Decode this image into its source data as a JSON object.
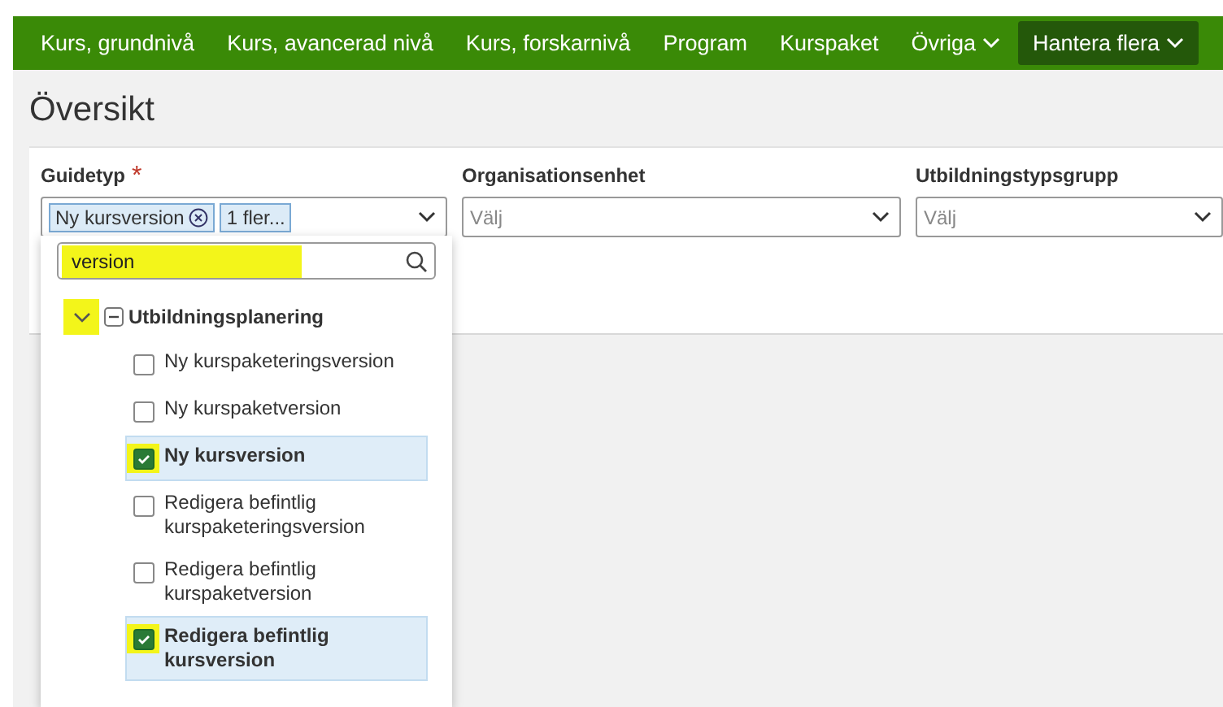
{
  "nav": {
    "items": [
      {
        "label": "Kurs, grundnivå",
        "selected": false,
        "menu": false
      },
      {
        "label": "Kurs, avancerad nivå",
        "selected": false,
        "menu": false
      },
      {
        "label": "Kurs, forskarnivå",
        "selected": false,
        "menu": false
      },
      {
        "label": "Program",
        "selected": false,
        "menu": false
      },
      {
        "label": "Kurspaket",
        "selected": false,
        "menu": false
      },
      {
        "label": "Övriga",
        "selected": false,
        "menu": true
      },
      {
        "label": "Hantera flera",
        "selected": true,
        "menu": true
      }
    ]
  },
  "page_title": "Översikt",
  "filters": [
    {
      "label": "Guidetyp",
      "required_mark": "*",
      "tags": [
        {
          "label": "Ny kursversion",
          "removable": true
        },
        {
          "label": "1 fler...",
          "removable": false
        }
      ]
    },
    {
      "label": "Organisationsenhet",
      "placeholder": "Välj"
    },
    {
      "label": "Utbildningstypsgrupp",
      "placeholder": "Välj"
    }
  ],
  "dropdown": {
    "search": {
      "value": "version",
      "highlighted": true
    },
    "groups": [
      {
        "label": "Utbildningsplanering",
        "expanded": true,
        "toggle_highlighted": true,
        "indeterminate": true,
        "children": [
          {
            "label": "Ny kurspaketeringsversion",
            "checked": false,
            "highlighted": false
          },
          {
            "label": "Ny kurspaketversion",
            "checked": false,
            "highlighted": false
          },
          {
            "label": "Ny kursversion",
            "checked": true,
            "highlighted": true
          },
          {
            "label": "Redigera befintlig kurspaketeringsversion",
            "checked": false,
            "highlighted": false
          },
          {
            "label": "Redigera befintlig kurspaketversion",
            "checked": false,
            "highlighted": false
          },
          {
            "label": "Redigera befintlig kursversion",
            "checked": true,
            "highlighted": true
          }
        ]
      }
    ]
  }
}
